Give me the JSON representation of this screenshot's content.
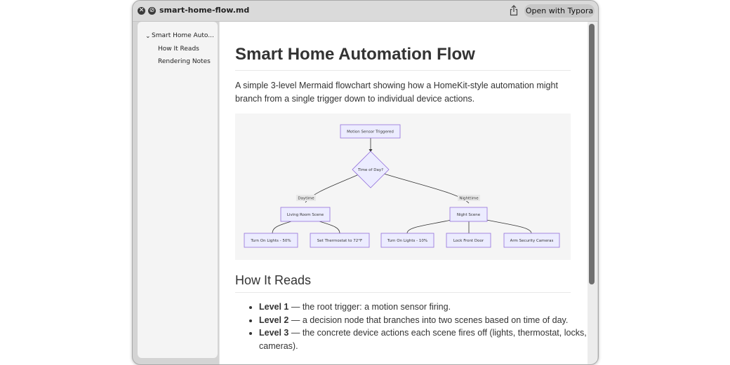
{
  "window": {
    "title": "smart-home-flow.md",
    "open_button": "Open with Typora"
  },
  "sidebar": {
    "items": [
      {
        "label": "Smart Home Auto...",
        "level": 1,
        "expanded": true
      },
      {
        "label": "How It Reads",
        "level": 2
      },
      {
        "label": "Rendering Notes",
        "level": 2
      }
    ]
  },
  "document": {
    "title": "Smart Home Automation Flow",
    "intro": "A simple 3-level Mermaid flowchart showing how a HomeKit-style automation might branch from a single trigger down to individual device actions.",
    "diagram": {
      "nodes": {
        "trigger": "Motion Sensor Triggered",
        "decision": "Time of Day?",
        "scene_day": "Living Room Scene",
        "scene_night": "Night Scene",
        "a1": "Turn On Lights - 50%",
        "a2": "Set Thermostat to 72°F",
        "a3": "Turn On Lights - 10%",
        "a4": "Lock Front Door",
        "a5": "Arm Security Cameras"
      },
      "edge_labels": {
        "day": "Daytime",
        "night": "Nighttime"
      }
    },
    "section_heading": "How It Reads",
    "bullets": [
      {
        "bold": "Level 1",
        "text": " — the root trigger: a motion sensor firing."
      },
      {
        "bold": "Level 2",
        "text": " — a decision node that branches into two scenes based on time of day."
      },
      {
        "bold": "Level 3",
        "text": " — the concrete device actions each scene fires off (lights, thermostat, locks, cameras)."
      }
    ]
  },
  "colors": {
    "node_fill": "#ececff",
    "node_stroke": "#9370db",
    "diagram_bg": "#f5f5f5"
  }
}
